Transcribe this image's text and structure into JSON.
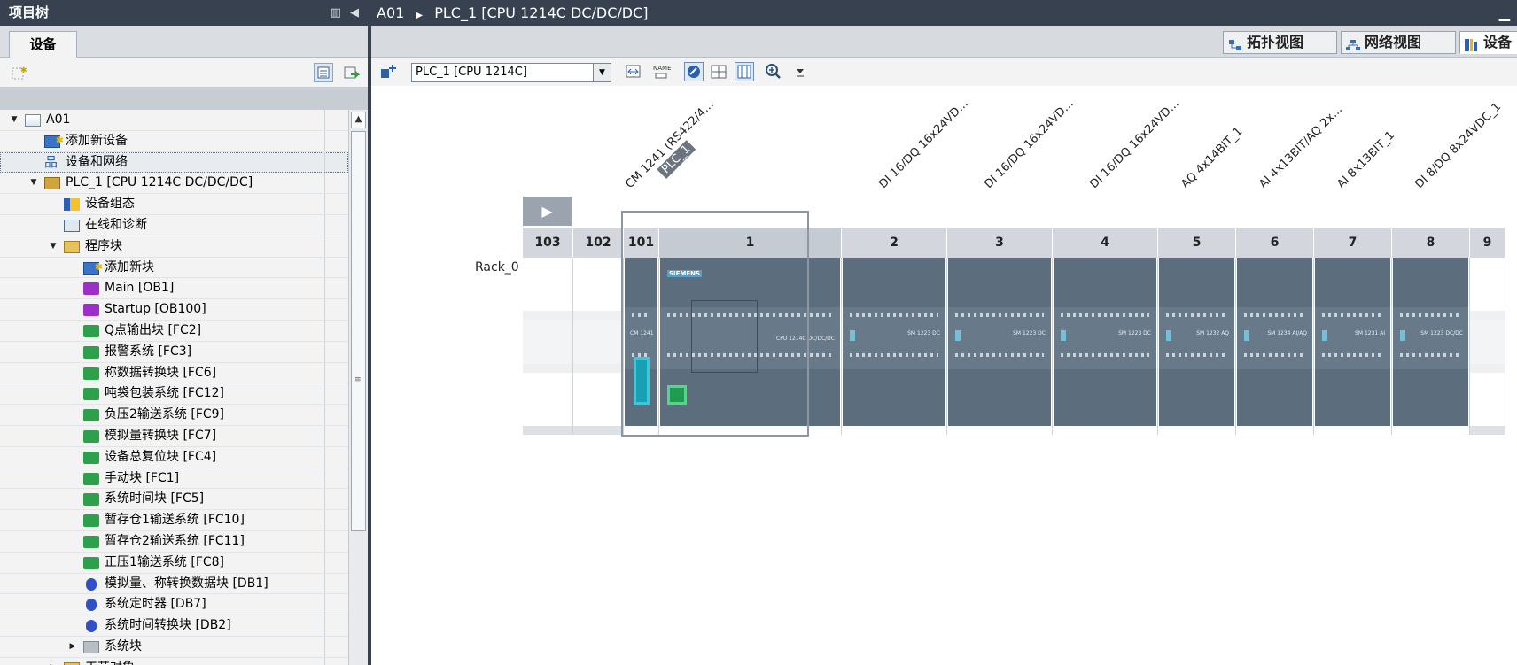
{
  "tree": {
    "title": "项目树",
    "tab": "设备",
    "rows": [
      {
        "label": "A01",
        "twisty": "▼",
        "icon": "project-icon",
        "level": 0
      },
      {
        "label": "添加新设备",
        "twisty": "",
        "icon": "add-device-icon",
        "level": 1
      },
      {
        "label": "设备和网络",
        "twisty": "",
        "icon": "network-icon",
        "level": 1,
        "selected": true
      },
      {
        "label": "PLC_1 [CPU 1214C DC/DC/DC]",
        "twisty": "▼",
        "icon": "plc-icon",
        "level": 1
      },
      {
        "label": "设备组态",
        "twisty": "",
        "icon": "device-config-icon",
        "level": 2
      },
      {
        "label": "在线和诊断",
        "twisty": "",
        "icon": "diagnostics-icon",
        "level": 2
      },
      {
        "label": "程序块",
        "twisty": "▼",
        "icon": "folder-icon",
        "level": 2
      },
      {
        "label": "添加新块",
        "twisty": "",
        "icon": "add-block-icon",
        "level": 3
      },
      {
        "label": "Main [OB1]",
        "twisty": "",
        "icon": "ob-icon",
        "level": 3
      },
      {
        "label": "Startup [OB100]",
        "twisty": "",
        "icon": "ob-icon",
        "level": 3
      },
      {
        "label": "Q点输出块 [FC2]",
        "twisty": "",
        "icon": "fc-icon",
        "level": 3
      },
      {
        "label": "报警系统 [FC3]",
        "twisty": "",
        "icon": "fc-icon",
        "level": 3
      },
      {
        "label": "称数据转换块 [FC6]",
        "twisty": "",
        "icon": "fc-icon",
        "level": 3
      },
      {
        "label": "吨袋包装系统 [FC12]",
        "twisty": "",
        "icon": "fc-icon",
        "level": 3
      },
      {
        "label": "负压2输送系统 [FC9]",
        "twisty": "",
        "icon": "fc-icon",
        "level": 3
      },
      {
        "label": "模拟量转换块 [FC7]",
        "twisty": "",
        "icon": "fc-icon",
        "level": 3
      },
      {
        "label": "设备总复位块 [FC4]",
        "twisty": "",
        "icon": "fc-icon",
        "level": 3
      },
      {
        "label": "手动块 [FC1]",
        "twisty": "",
        "icon": "fc-icon",
        "level": 3
      },
      {
        "label": "系统时间块 [FC5]",
        "twisty": "",
        "icon": "fc-icon",
        "level": 3
      },
      {
        "label": "暂存仓1输送系统 [FC10]",
        "twisty": "",
        "icon": "fc-icon",
        "level": 3
      },
      {
        "label": "暂存仓2输送系统 [FC11]",
        "twisty": "",
        "icon": "fc-icon",
        "level": 3
      },
      {
        "label": "正压1输送系统 [FC8]",
        "twisty": "",
        "icon": "fc-icon",
        "level": 3
      },
      {
        "label": "模拟量、称转换数据块 [DB1]",
        "twisty": "",
        "icon": "db-icon",
        "level": 3
      },
      {
        "label": "系统定时器 [DB7]",
        "twisty": "",
        "icon": "db-icon",
        "level": 3
      },
      {
        "label": "系统时间转换块 [DB2]",
        "twisty": "",
        "icon": "db-icon",
        "level": 3
      },
      {
        "label": "系统块",
        "twisty": "▶",
        "icon": "system-block-icon",
        "level": 3
      },
      {
        "label": "工艺对象",
        "twisty": "▶",
        "icon": "folder-icon",
        "level": 2
      }
    ]
  },
  "editor": {
    "breadcrumb": [
      "A01",
      "PLC_1 [CPU 1214C DC/DC/DC]"
    ],
    "views": [
      "拓扑视图",
      "网络视图",
      "设备"
    ],
    "device_select": "PLC_1 [CPU 1214C]",
    "rack_name": "Rack_0",
    "slots": [
      {
        "num": "103",
        "label": "",
        "module": "",
        "kind": "empty"
      },
      {
        "num": "102",
        "label": "",
        "module": "",
        "kind": "empty"
      },
      {
        "num": "101",
        "label": "CM 1241 (RS422/4...",
        "module": "CM 1241",
        "kind": "cm"
      },
      {
        "num": "1",
        "label": "PLC_1",
        "module": "CPU 1214C DC/DC/DC",
        "kind": "cpu",
        "selected": true
      },
      {
        "num": "2",
        "label": "DI 16/DQ 16x24VD...",
        "module": "SM 1223 DC",
        "kind": "sm"
      },
      {
        "num": "3",
        "label": "DI 16/DQ 16x24VD...",
        "module": "SM 1223 DC",
        "kind": "sm"
      },
      {
        "num": "4",
        "label": "DI 16/DQ 16x24VD...",
        "module": "SM 1223 DC",
        "kind": "sm"
      },
      {
        "num": "5",
        "label": "AQ 4x14BIT_1",
        "module": "SM 1232 AQ",
        "kind": "sm"
      },
      {
        "num": "6",
        "label": "AI 4x13BIT/AQ 2x...",
        "module": "SM 1234 AI/AQ",
        "kind": "sm"
      },
      {
        "num": "7",
        "label": "AI 8x13BIT_1",
        "module": "SM 1231 AI",
        "kind": "sm"
      },
      {
        "num": "8",
        "label": "DI 8/DQ 8x24VDC_1",
        "module": "SM 1223 DC/DC",
        "kind": "sm"
      },
      {
        "num": "9",
        "label": "",
        "module": "",
        "kind": "empty"
      }
    ],
    "brand": "SIEMENS"
  }
}
